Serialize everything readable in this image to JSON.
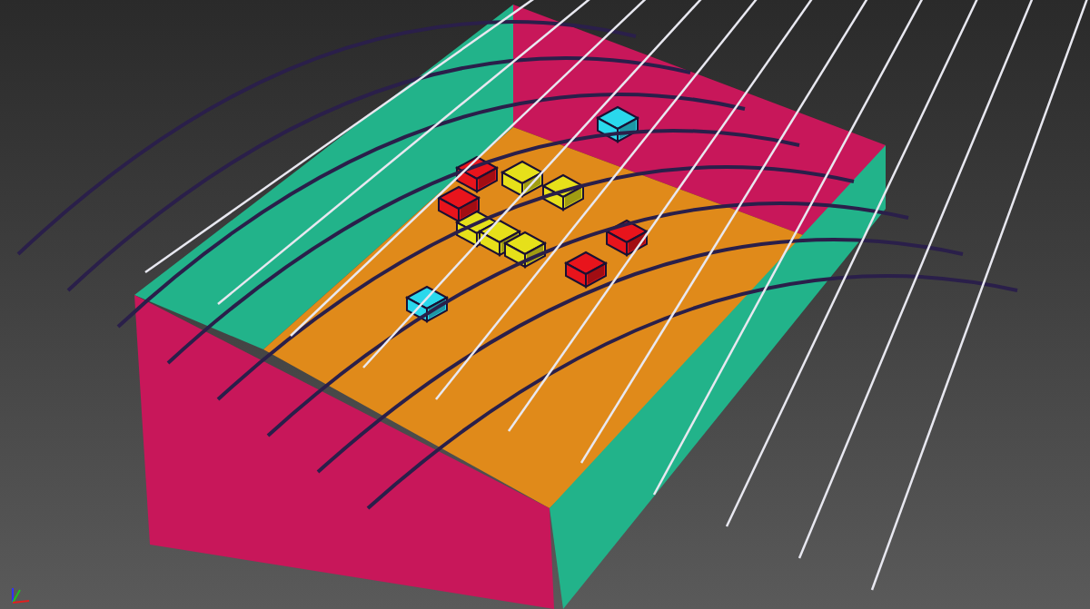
{
  "viewport": {
    "scene": {
      "crates": [
        {
          "color": "#e8141c"
        },
        {
          "color": "#e8141c"
        },
        {
          "color": "#e8141c"
        },
        {
          "color": "#e8141c"
        },
        {
          "color": "#e6e01a"
        },
        {
          "color": "#e6e01a"
        },
        {
          "color": "#e6e01a"
        },
        {
          "color": "#e6e01a"
        },
        {
          "color": "#e6e01a"
        },
        {
          "color": "#2ad8ec"
        },
        {
          "color": "#2ad8ec"
        }
      ]
    }
  }
}
